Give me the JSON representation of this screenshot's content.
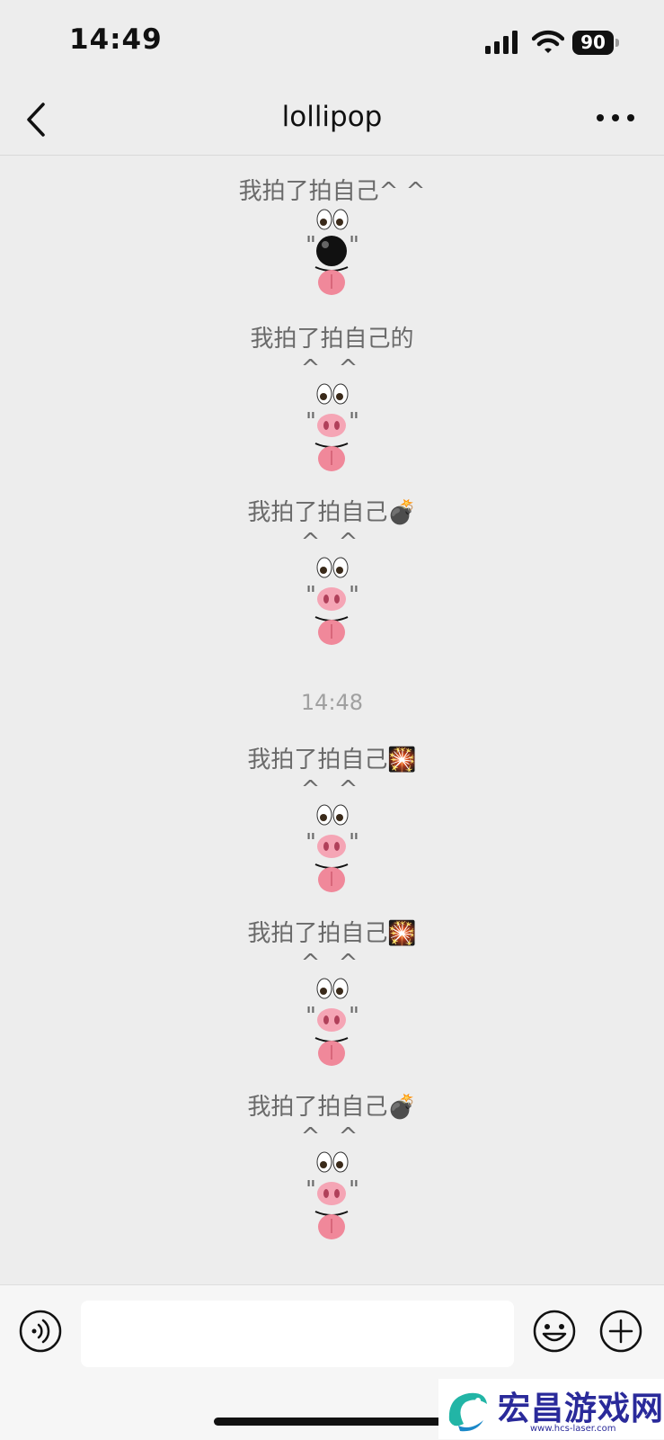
{
  "status_bar": {
    "time": "14:49",
    "battery": "90"
  },
  "nav": {
    "title": "lollipop"
  },
  "messages": [
    {
      "text": "我拍了拍自己^ ^",
      "caret": "",
      "nose": "black"
    },
    {
      "text": "我拍了拍自己的",
      "caret": "^ ^",
      "nose": "pig"
    },
    {
      "text": "我拍了拍自己💣",
      "caret": "^ ^",
      "nose": "pig"
    },
    {
      "text": "我拍了拍自己🎇",
      "caret": "^ ^",
      "nose": "pig"
    },
    {
      "text": "我拍了拍自己🎇",
      "caret": "^ ^",
      "nose": "pig"
    },
    {
      "text": "我拍了拍自己💣",
      "caret": "^ ^",
      "nose": "pig"
    }
  ],
  "timestamp": "14:48",
  "input": {
    "placeholder": "",
    "value": ""
  },
  "watermark": {
    "text": "宏昌游戏网",
    "url": "www.hcs-laser.com"
  }
}
